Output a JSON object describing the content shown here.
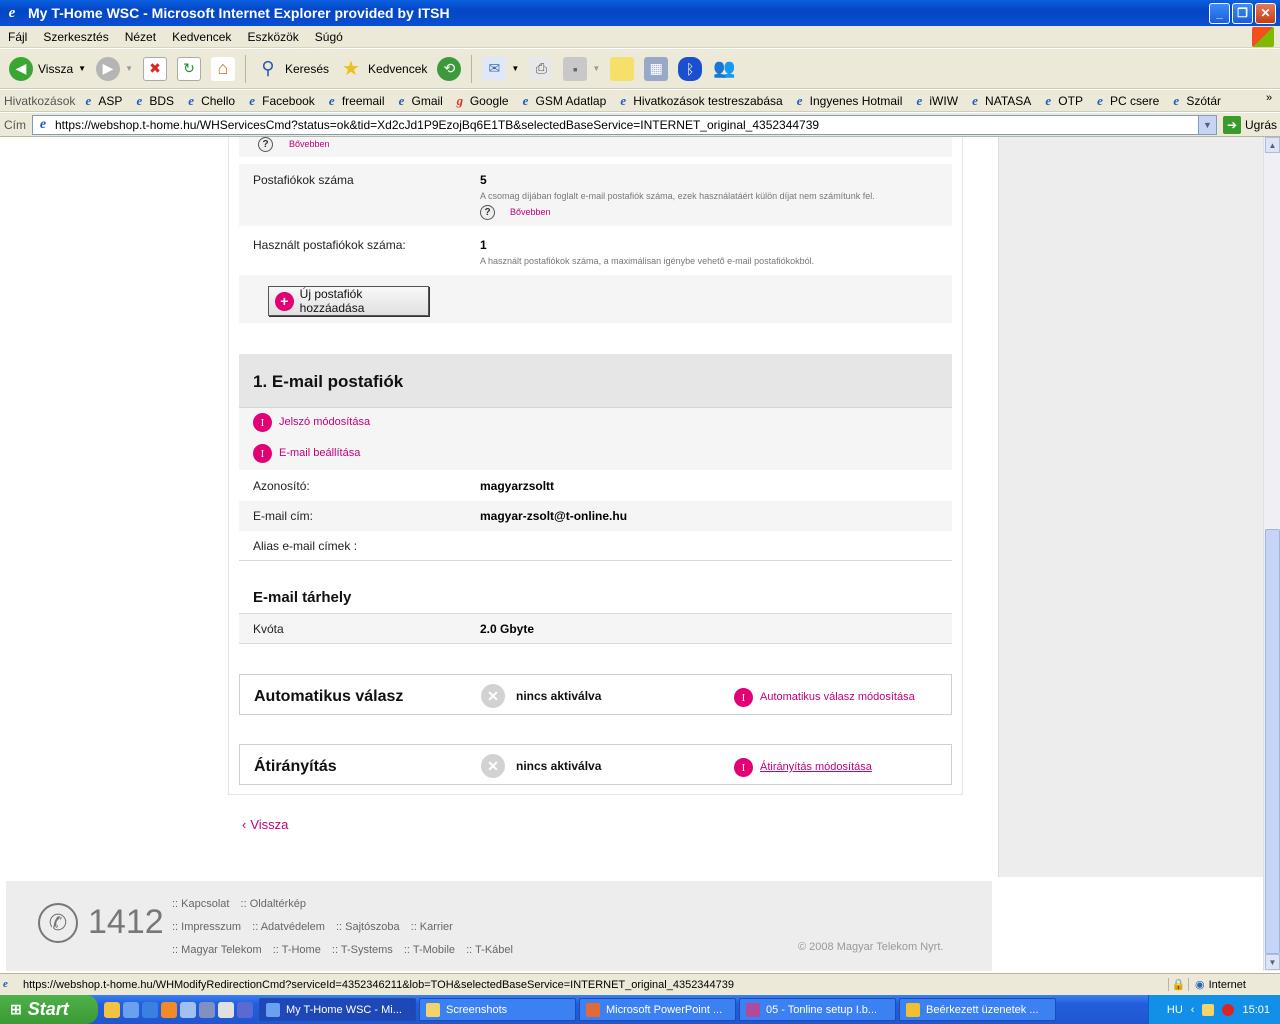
{
  "window": {
    "title": "My T-Home WSC - Microsoft Internet Explorer provided by ITSH"
  },
  "menu": [
    "Fájl",
    "Szerkesztés",
    "Nézet",
    "Kedvencek",
    "Eszközök",
    "Súgó"
  ],
  "toolbar": {
    "back": "Vissza",
    "search": "Keresés",
    "favorites": "Kedvencek"
  },
  "links": {
    "label": "Hivatkozások",
    "items": [
      "ASP",
      "BDS",
      "Chello",
      "Facebook",
      "freemail",
      "Gmail",
      "Google",
      "GSM Adatlap",
      "Hivatkozások testreszabása",
      "Ingyenes Hotmail",
      "iWIW",
      "NATASA",
      "OTP",
      "PC csere",
      "Szótár"
    ]
  },
  "address": {
    "label": "Cím",
    "url": "https://webshop.t-home.hu/WHServicesCmd?status=ok&tid=Xd2cJd1P9EzojBq6E1TB&selectedBaseService=INTERNET_original_4352344739",
    "go": "Ugrás"
  },
  "top": {
    "more": "Bővebben"
  },
  "mailboxes": {
    "count_label": "Postafiókok száma",
    "count_value": "5",
    "count_desc": "A csomag díjában foglalt e-mail postafiók száma, ezek használatáért külön díjat nem számítunk fel.",
    "count_more": "Bővebben",
    "used_label": "Használt postafiókok száma:",
    "used_value": "1",
    "used_desc": "A használt postafiókok száma, a maximálisan igénybe vehető e-mail postafiókokból.",
    "add_button": "Új postafiók hozzáadása"
  },
  "mailbox1": {
    "title": "1. E-mail postafiók",
    "pw_link": "Jelszó módosítása",
    "settings_link": "E-mail beállítása",
    "id_label": "Azonosító:",
    "id_value": "magyarzsoltt",
    "email_label": "E-mail cím:",
    "email_value": "magyar-zsolt@t-online.hu",
    "alias_label": "Alias e-mail címek :"
  },
  "storage": {
    "title": "E-mail tárhely",
    "quota_label": "Kvóta",
    "quota_value": "2.0 Gbyte"
  },
  "autoreply": {
    "title": "Automatikus válasz",
    "status": "nincs aktiválva",
    "link": "Automatikus válasz módosítása"
  },
  "redirect": {
    "title": "Átirányítás",
    "status": "nincs aktiválva",
    "link": "Átirányítás módosítása"
  },
  "back_link": "Vissza",
  "footer": {
    "phone": "1412",
    "row1": [
      ":: Kapcsolat",
      ":: Oldaltérkép"
    ],
    "row2": [
      ":: Impresszum",
      ":: Adatvédelem",
      ":: Sajtószoba",
      ":: Karrier"
    ],
    "row3": [
      ":: Magyar Telekom",
      ":: T-Home",
      ":: T-Systems",
      ":: T-Mobile",
      ":: T-Kábel"
    ],
    "copyright": "© 2008 Magyar Telekom Nyrt."
  },
  "status": {
    "url": "https://webshop.t-home.hu/WHModifyRedirectionCmd?serviceId=4352346211&lob=TOH&selectedBaseService=INTERNET_original_4352344739",
    "zone": "Internet"
  },
  "taskbar": {
    "start": "Start",
    "buttons": [
      "My T-Home WSC - Mi...",
      "Screenshots",
      "Microsoft PowerPoint ...",
      "05 - Tonline setup I.b...",
      "Beérkezett üzenetek ..."
    ],
    "lang": "HU",
    "time": "15:01"
  },
  "colors": {
    "accent": "#e20074",
    "xp_blue": "#245edc"
  }
}
